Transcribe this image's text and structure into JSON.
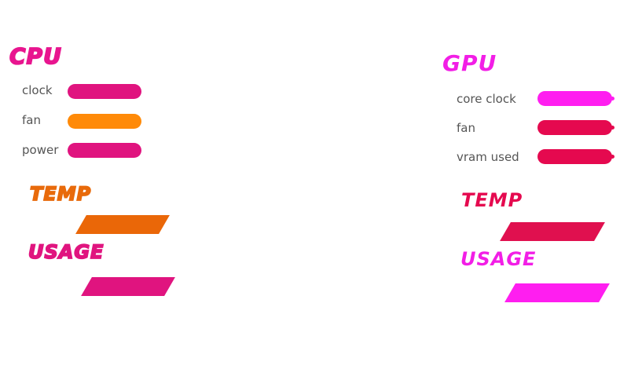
{
  "cpu": {
    "title": "CPU",
    "title_color": "#e8158f",
    "metrics": [
      {
        "label": "clock",
        "color": "#e0147f"
      },
      {
        "label": "fan",
        "color": "#ff8a08"
      },
      {
        "label": "power",
        "color": "#e0147f"
      }
    ],
    "temp": {
      "title": "TEMP",
      "title_color": "#e86a0b",
      "bar_color": "#ea6708"
    },
    "usage": {
      "title": "USAGE",
      "title_color": "#e0147f",
      "bar_color": "#e0147f"
    }
  },
  "gpu": {
    "title": "GPU",
    "title_color": "#f21ee6",
    "metrics": [
      {
        "label": "core clock",
        "color": "#ff1ef0"
      },
      {
        "label": "fan",
        "color": "#e5094f"
      },
      {
        "label": "vram used",
        "color": "#e5094f"
      }
    ],
    "temp": {
      "title": "TEMP",
      "title_color": "#e5094f",
      "bar_color": "#e0104f"
    },
    "usage": {
      "title": "USAGE",
      "title_color": "#f21ee6",
      "bar_color": "#ff1ef0"
    }
  }
}
